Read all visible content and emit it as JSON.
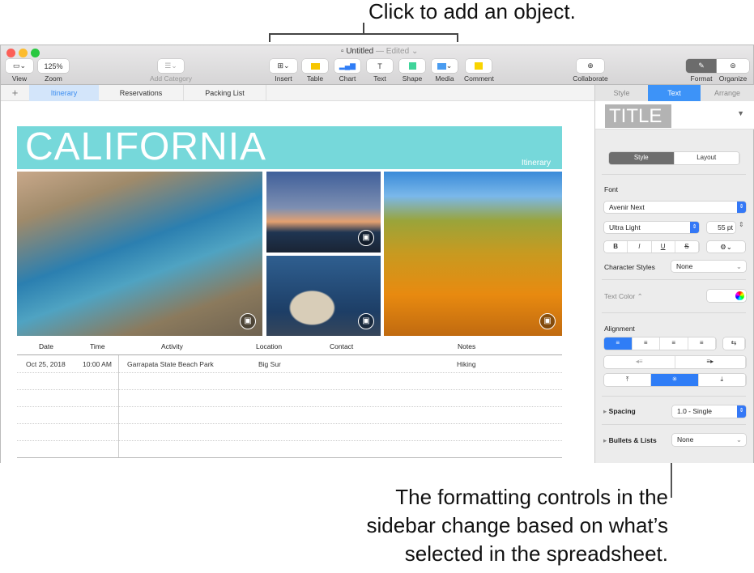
{
  "callouts": {
    "top": "Click to add an object.",
    "bottom": [
      "The formatting controls in the",
      "sidebar change based on what’s",
      "selected in the spreadsheet."
    ]
  },
  "window": {
    "title": "Untitled",
    "status": "— Edited"
  },
  "toolbar": {
    "view": "View",
    "zoom_value": "125%",
    "zoom": "Zoom",
    "add_category": "Add Category",
    "insert": "Insert",
    "table": "Table",
    "chart": "Chart",
    "text": "Text",
    "shape": "Shape",
    "media": "Media",
    "comment": "Comment",
    "collaborate": "Collaborate",
    "format": "Format",
    "organize": "Organize"
  },
  "sheets": {
    "add": "+",
    "tabs": [
      "Itinerary",
      "Reservations",
      "Packing List"
    ]
  },
  "canvas": {
    "banner_title": "CALIFORNIA",
    "banner_sub": "Itinerary",
    "table": {
      "headers": [
        "Date",
        "Time",
        "Activity",
        "Location",
        "Contact",
        "Notes"
      ],
      "rows": [
        [
          "Oct 25, 2018",
          "10:00 AM",
          "Garrapata State Beach Park",
          "Big Sur",
          "",
          "Hiking"
        ]
      ]
    }
  },
  "sidebar": {
    "tabs": [
      "Style",
      "Text",
      "Arrange"
    ],
    "style_preview": "TITLE",
    "segments": [
      "Style",
      "Layout"
    ],
    "font_label": "Font",
    "font": "Avenir Next",
    "weight": "Ultra Light",
    "size": "55 pt",
    "bius": [
      "B",
      "I",
      "U",
      "S"
    ],
    "gear": "⚙︎⌄",
    "char_styles_label": "Character Styles",
    "char_styles": "None",
    "text_color_label": "Text Color ⌃",
    "alignment_label": "Alignment",
    "spacing_label": "Spacing",
    "spacing": "1.0 - Single",
    "bullets_label": "Bullets & Lists",
    "bullets": "None"
  },
  "colors": {
    "accent": "#2f7df6",
    "banner": "#76d8da"
  }
}
